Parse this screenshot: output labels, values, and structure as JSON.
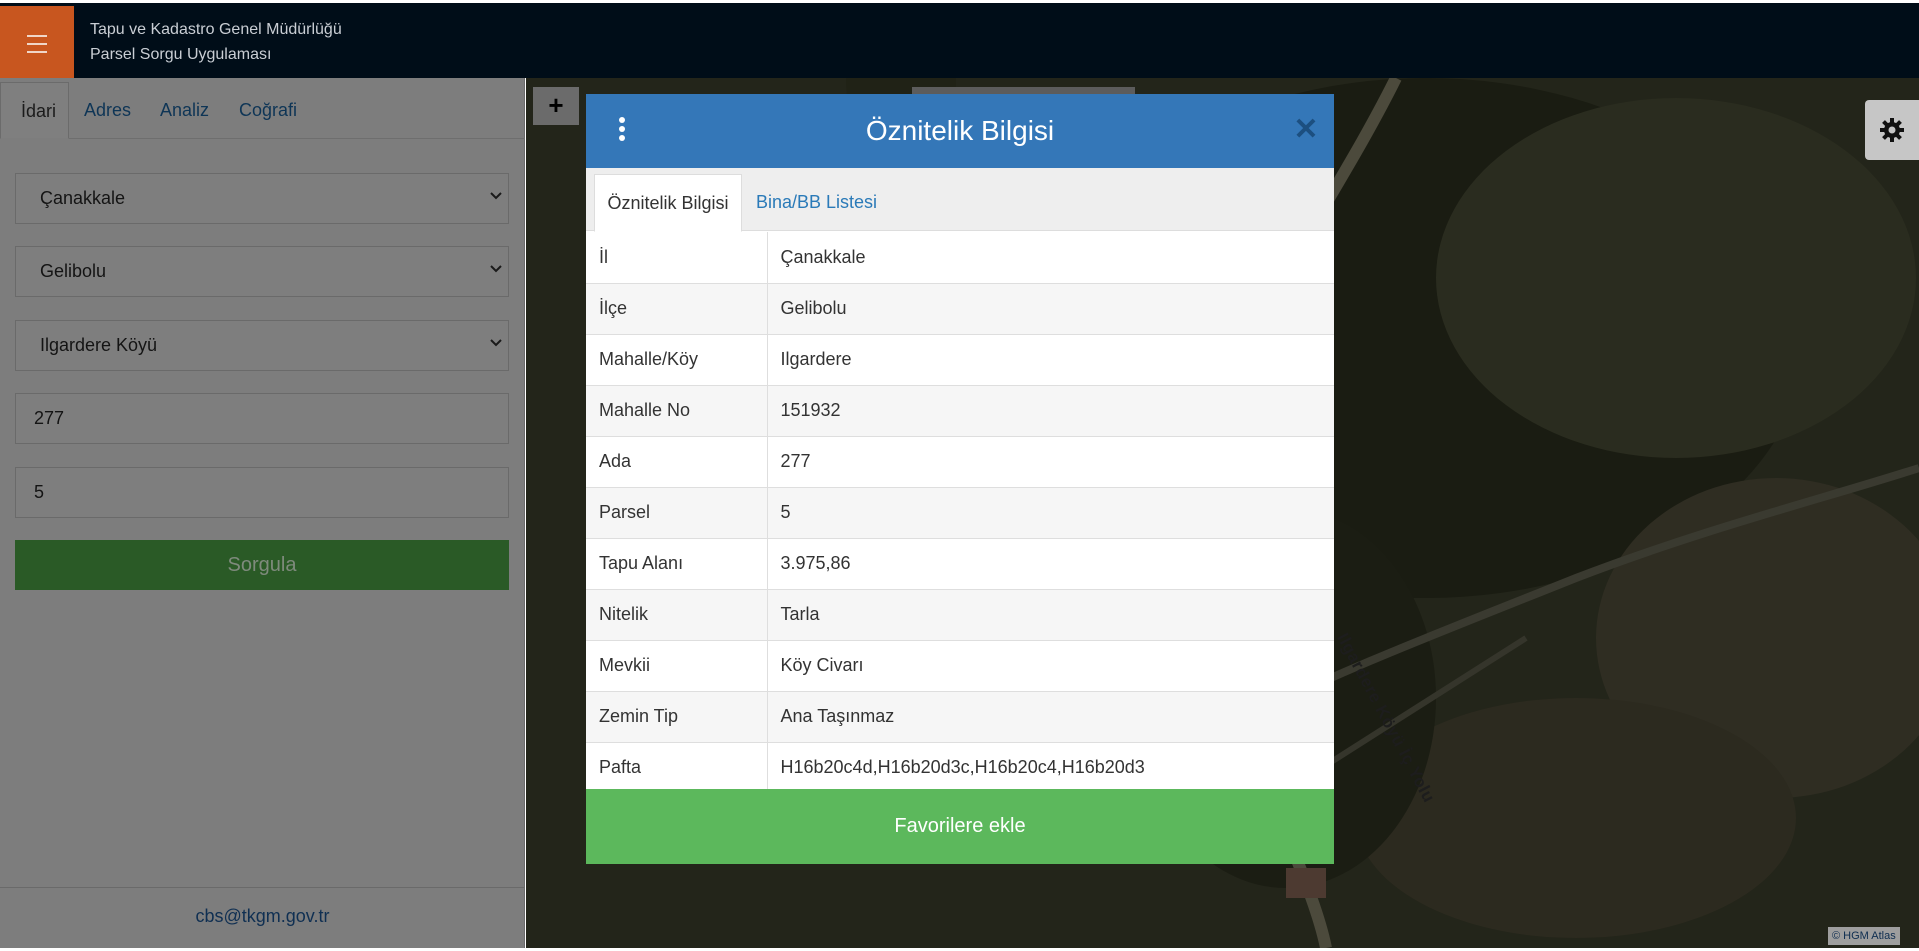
{
  "header": {
    "title_line1": "Tapu ve Kadastro Genel Müdürlüğü",
    "title_line2": "Parsel Sorgu Uygulaması"
  },
  "sidebar": {
    "tabs": [
      "İdari",
      "Adres",
      "Analiz",
      "Coğrafi"
    ],
    "active_tab": "İdari",
    "fields": {
      "il": "Çanakkale",
      "ilce": "Gelibolu",
      "mahalle": "Ilgardere Köyü",
      "ada": "277",
      "parsel": "5"
    },
    "query_button": "Sorgula",
    "email": "cbs@tkgm.gov.tr"
  },
  "map": {
    "road_label": "Ilgardere Köyü İç Yolu",
    "attribution": "© HGM Atlas",
    "zoom_in": "+"
  },
  "modal": {
    "title": "Öznitelik Bilgisi",
    "close": "✕",
    "tabs": [
      "Öznitelik Bilgisi",
      "Bina/BB Listesi"
    ],
    "rows": [
      {
        "key": "İl",
        "value": "Çanakkale"
      },
      {
        "key": "İlçe",
        "value": "Gelibolu"
      },
      {
        "key": "Mahalle/Köy",
        "value": "Ilgardere"
      },
      {
        "key": "Mahalle No",
        "value": "151932"
      },
      {
        "key": "Ada",
        "value": "277"
      },
      {
        "key": "Parsel",
        "value": "5"
      },
      {
        "key": "Tapu Alanı",
        "value": "3.975,86"
      },
      {
        "key": "Nitelik",
        "value": "Tarla"
      },
      {
        "key": "Mevkii",
        "value": "Köy Civarı"
      },
      {
        "key": "Zemin Tip",
        "value": "Ana Taşınmaz"
      },
      {
        "key": "Pafta",
        "value": "H16b20c4d,H16b20d3c,H16b20c4,H16b20d3"
      }
    ],
    "favorite_button": "Favorilere ekle"
  },
  "colors": {
    "header_bg": "#000d18",
    "menu_accent": "#c8561f",
    "modal_header": "#3477b8",
    "favorite_green": "#5cb85c",
    "query_green": "#2a5a26"
  }
}
